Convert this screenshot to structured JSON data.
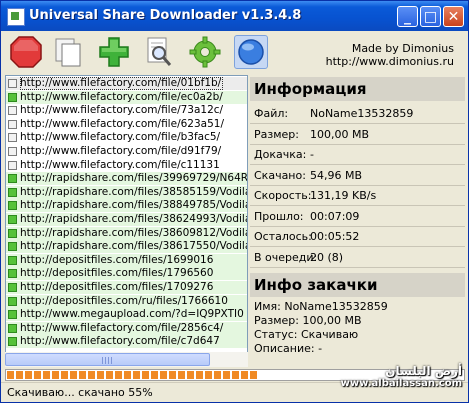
{
  "window": {
    "title": "Universal Share Downloader v1.3.4.8"
  },
  "toolbar": {
    "buttons": [
      "stop-icon",
      "copy-icon",
      "add-icon",
      "search-icon",
      "settings-icon",
      "globe-icon"
    ],
    "made_by": "Made by Dimonius",
    "site": "http://www.dimonius.ru"
  },
  "list": {
    "items": [
      {
        "url": "http://www.filefactory.com/file/01bf1b/",
        "state": "selected"
      },
      {
        "url": "http://www.filefactory.com/file/ec0a2b/",
        "state": "done"
      },
      {
        "url": "http://www.filefactory.com/file/73a12c/",
        "state": "pending"
      },
      {
        "url": "http://www.filefactory.com/file/623a51/",
        "state": "pending"
      },
      {
        "url": "http://www.filefactory.com/file/b3fac5/",
        "state": "pending"
      },
      {
        "url": "http://www.filefactory.com/file/d91f79/",
        "state": "pending"
      },
      {
        "url": "http://www.filefactory.com/file/c11131",
        "state": "pending"
      },
      {
        "url": "http://rapidshare.com/files/39969729/N64RP3E",
        "state": "done"
      },
      {
        "url": "http://rapidshare.com/files/38585159/Vodila.par",
        "state": "done"
      },
      {
        "url": "http://rapidshare.com/files/38849785/Vodila.par",
        "state": "done"
      },
      {
        "url": "http://rapidshare.com/files/38624993/Vodila.par",
        "state": "done"
      },
      {
        "url": "http://rapidshare.com/files/38609812/Vodila.par",
        "state": "done"
      },
      {
        "url": "http://rapidshare.com/files/38617550/Vodila.par",
        "state": "done"
      },
      {
        "url": "http://depositfiles.com/files/1699016",
        "state": "done"
      },
      {
        "url": "http://depositfiles.com/files/1796560",
        "state": "done"
      },
      {
        "url": "http://depositfiles.com/files/1709276",
        "state": "done"
      },
      {
        "url": "http://depositfiles.com/ru/files/1766610",
        "state": "done"
      },
      {
        "url": "http://www.megaupload.com/?d=IQ9PXTI0",
        "state": "done"
      },
      {
        "url": "http://www.filefactory.com/file/2856c4/",
        "state": "done"
      },
      {
        "url": "http://www.filefactory.com/file/c7d647",
        "state": "done"
      }
    ]
  },
  "info": {
    "heading": "Информация",
    "rows": [
      {
        "label": "Файл:",
        "value": "NoName13532859"
      },
      {
        "label": "Размер:",
        "value": "100,00 MB"
      },
      {
        "label": "Докачка:",
        "value": "-"
      },
      {
        "label": "Скачано:",
        "value": "54,96 MB"
      },
      {
        "label": "Скорость:",
        "value": "131,19 KB/s"
      },
      {
        "label": "Прошло:",
        "value": "00:07:09"
      },
      {
        "label": "Осталось:",
        "value": "00:05:52"
      },
      {
        "label": "В очереди:",
        "value": "20 (8)"
      }
    ]
  },
  "download_info": {
    "heading": "Инфо закачки",
    "lines": [
      "Имя: NoName13532859",
      "Размер: 100,00 MB",
      "Статус: Скачиваю",
      "Описание: -"
    ]
  },
  "progress": {
    "value": 0.55
  },
  "status": {
    "text": "Скачиваю... скачано 55%"
  },
  "watermark": {
    "arabic": "أرض البلسان",
    "url": "www.albailassan.com"
  }
}
